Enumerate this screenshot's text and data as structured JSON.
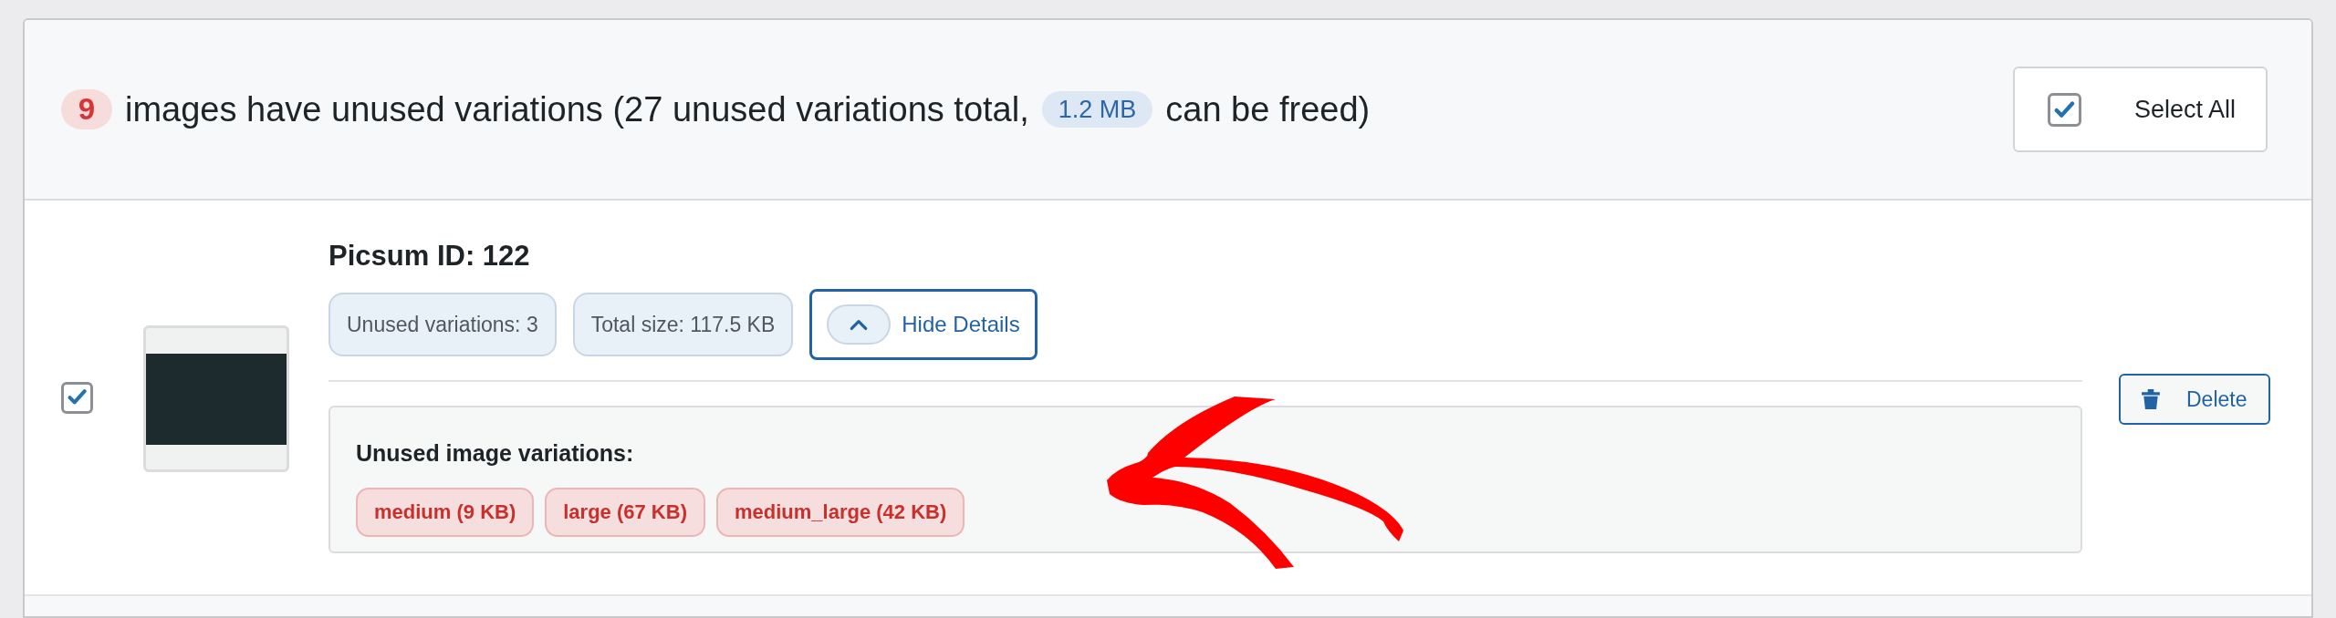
{
  "summary": {
    "image_count": "9",
    "text_before": "images have unused variations (27 unused variations total,",
    "freed_size": "1.2 MB",
    "text_after": "can be freed)"
  },
  "select_all": {
    "label": "Select All",
    "checked": true
  },
  "items": [
    {
      "checked": true,
      "title": "Picsum ID: 122",
      "pills": [
        "Unused variations: 3",
        "Total size: 117.5 KB"
      ],
      "details_button": "Hide Details",
      "expanded": true,
      "details_heading": "Unused image variations:",
      "variations": [
        "medium (9 KB)",
        "large (67 KB)",
        "medium_large (42 KB)"
      ],
      "delete_button": "Delete"
    }
  ]
}
